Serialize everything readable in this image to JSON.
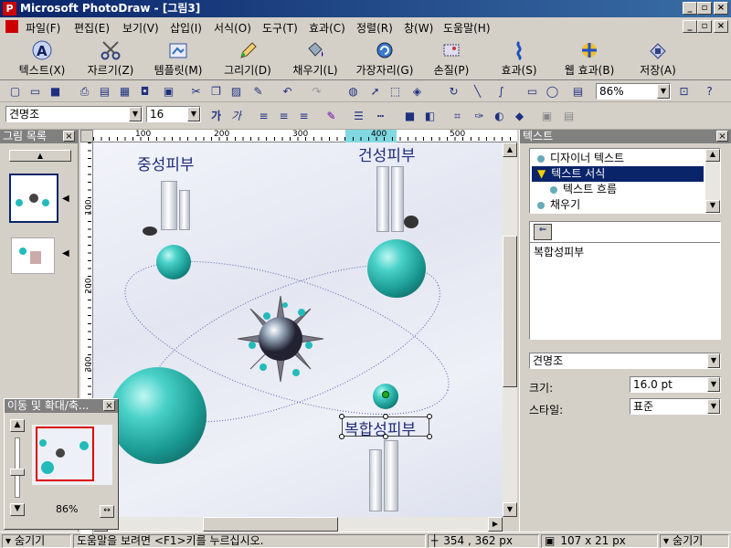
{
  "window": {
    "title": "Microsoft PhotoDraw - [그림3]"
  },
  "menu": [
    "파일(F)",
    "편집(E)",
    "보기(V)",
    "삽입(I)",
    "서식(O)",
    "도구(T)",
    "효과(C)",
    "정렬(R)",
    "창(W)",
    "도움말(H)"
  ],
  "bigtoolbar": [
    {
      "label": "텍스트(X)",
      "icon": "text-A-icon"
    },
    {
      "label": "자르기(Z)",
      "icon": "scissors-icon"
    },
    {
      "label": "템플릿(M)",
      "icon": "template-icon"
    },
    {
      "label": "그리기(D)",
      "icon": "pencil-icon"
    },
    {
      "label": "채우기(L)",
      "icon": "paint-bucket-icon"
    },
    {
      "label": "가장자리(G)",
      "icon": "edge-icon"
    },
    {
      "label": "손질(P)",
      "icon": "touchup-icon"
    },
    {
      "label": "효과(S)",
      "icon": "effects-icon"
    },
    {
      "label": "웹 효과(B)",
      "icon": "web-effects-icon"
    },
    {
      "label": "저장(A)",
      "icon": "save-icon"
    }
  ],
  "toolbar": {
    "zoom": "86%"
  },
  "formatbar": {
    "font": "견명조",
    "size": "16",
    "bold": "가",
    "italic": "가"
  },
  "picturelist": {
    "title": "그림 목록"
  },
  "zoompanel": {
    "title": "이동 및 확대/축...",
    "percent": "86%"
  },
  "ruler": {
    "h_ticks": [
      "100",
      "200",
      "300",
      "400",
      "500"
    ],
    "v_ticks": [
      "100",
      "200",
      "300"
    ]
  },
  "canvas": {
    "label_normal": "중성피부",
    "label_dry": "건성피부",
    "label_combo": "복합성피부"
  },
  "textpanel": {
    "title": "텍스트",
    "options": [
      "디자이너 텍스트",
      "텍스트 서식",
      "텍스트 흐름",
      "채우기"
    ],
    "text_value": "복합성피부",
    "font": "견명조",
    "size_label": "크기:",
    "size_value": "16.0 pt",
    "style_label": "스타일:",
    "style_value": "표준"
  },
  "status": {
    "hide_left": "숨기기",
    "help": "도움말을 보려면 <F1>키를 누르십시오.",
    "pos": "354 , 362  px",
    "size": "107 x 21  px",
    "hide_right": "숨기기"
  }
}
